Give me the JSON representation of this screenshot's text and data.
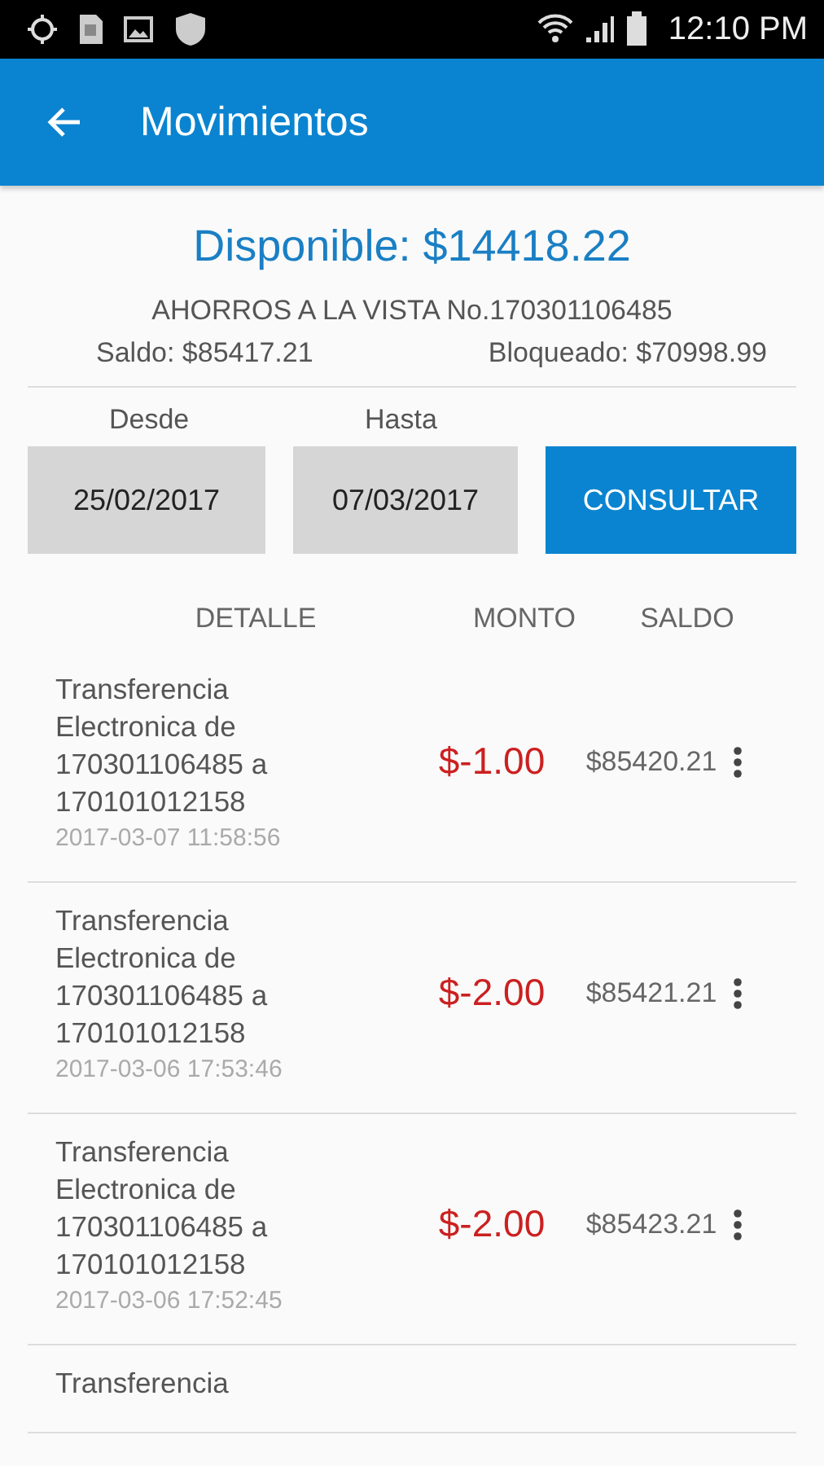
{
  "status_bar": {
    "time": "12:10 PM"
  },
  "app_bar": {
    "title": "Movimientos"
  },
  "account": {
    "available": "Disponible: $14418.22",
    "name": "AHORROS A LA VISTA No.170301106485",
    "balance": "Saldo: $85417.21",
    "blocked": "Bloqueado: $70998.99"
  },
  "filter": {
    "from_label": "Desde",
    "from_value": "25/02/2017",
    "to_label": "Hasta",
    "to_value": "07/03/2017",
    "button": "CONSULTAR"
  },
  "table": {
    "columns": [
      "DETALLE",
      "MONTO",
      "SALDO"
    ],
    "rows": [
      {
        "detail": "Transferencia Electronica de 170301106485 a 170101012158",
        "date": "2017-03-07 11:58:56",
        "amount": "$-1.00",
        "balance": "$85420.21"
      },
      {
        "detail": "Transferencia Electronica de 170301106485 a 170101012158",
        "date": "2017-03-06 17:53:46",
        "amount": "$-2.00",
        "balance": "$85421.21"
      },
      {
        "detail": "Transferencia Electronica de 170301106485 a 170101012158",
        "date": "2017-03-06 17:52:45",
        "amount": "$-2.00",
        "balance": "$85423.21"
      },
      {
        "detail": "Transferencia"
      }
    ]
  }
}
